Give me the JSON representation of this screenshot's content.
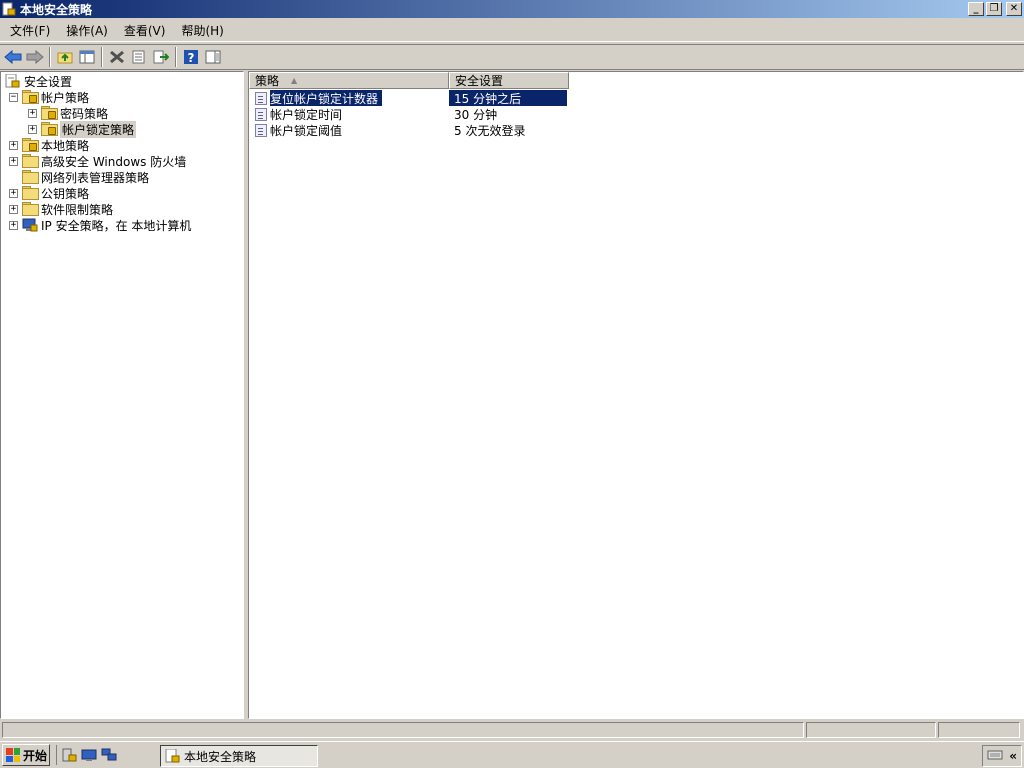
{
  "window": {
    "title": "本地安全策略"
  },
  "menu": [
    {
      "label": "文件(F)"
    },
    {
      "label": "操作(A)"
    },
    {
      "label": "查看(V)"
    },
    {
      "label": "帮助(H)"
    }
  ],
  "toolbar": {
    "icons": [
      "back-icon",
      "forward-icon",
      "up-folder-icon",
      "show-hide-tree-icon",
      "delete-icon",
      "properties-icon",
      "export-list-icon",
      "help-icon",
      "show-hide-action-pane-icon"
    ]
  },
  "tree": {
    "root": "安全设置",
    "account_policy": "帐户策略",
    "password_policy": "密码策略",
    "lockout_policy": "帐户锁定策略",
    "local_policy": "本地策略",
    "firewall": "高级安全 Windows 防火墙",
    "network_list": "网络列表管理器策略",
    "public_key": "公钥策略",
    "software_restriction": "软件限制策略",
    "ip_security": "IP 安全策略，在 本地计算机"
  },
  "list": {
    "columns": {
      "policy": "策略",
      "setting": "安全设置"
    },
    "rows": [
      {
        "policy": "复位帐户锁定计数器",
        "setting": "15 分钟之后"
      },
      {
        "policy": "帐户锁定时间",
        "setting": "30 分钟"
      },
      {
        "policy": "帐户锁定阈值",
        "setting": "5 次无效登录"
      }
    ]
  },
  "taskbar": {
    "start_label": "开始",
    "task_item": "本地安全策略",
    "tray_chevron": "«"
  },
  "colors": {
    "selection": "#0a246a",
    "title_start": "#0a246a",
    "title_end": "#a6caf0"
  }
}
